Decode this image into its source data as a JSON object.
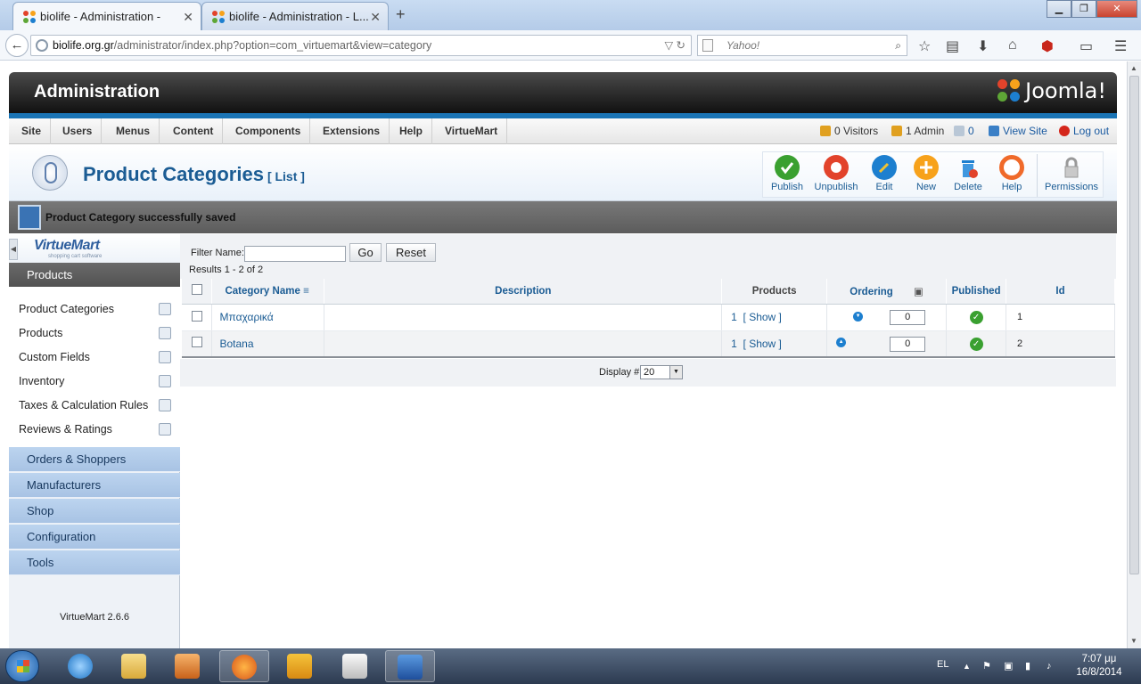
{
  "browser": {
    "tabs": [
      {
        "title": "biolife - Administration -"
      },
      {
        "title": "biolife - Administration - L..."
      }
    ],
    "url_domain": "biolife.org.gr",
    "url_path": "/administrator/index.php?option=com_virtuemart&view=category",
    "search_placeholder": "Yahoo!"
  },
  "header": {
    "title": "Administration",
    "brand": "Joomla!"
  },
  "menu": {
    "items": [
      "Site",
      "Users",
      "Menus",
      "Content",
      "Components",
      "Extensions",
      "Help",
      "VirtueMart"
    ],
    "visitors": "0 Visitors",
    "admins": "1 Admin",
    "messages": "0",
    "view_site": "View Site",
    "logout": "Log out"
  },
  "toolbar": {
    "page_title": "Product Categories",
    "page_subtitle": "[ List ]",
    "buttons": [
      "Publish",
      "Unpublish",
      "Edit",
      "New",
      "Delete",
      "Help",
      "Permissions"
    ]
  },
  "message": "Product Category successfully saved",
  "sidebar": {
    "logo_text": "VirtueMart",
    "logo_sub": "shopping cart software",
    "section": "Products",
    "items": [
      "Product Categories",
      "Products",
      "Custom Fields",
      "Inventory",
      "Taxes & Calculation Rules",
      "Reviews & Ratings"
    ],
    "groups": [
      "Orders & Shoppers",
      "Manufacturers",
      "Shop",
      "Configuration",
      "Tools"
    ],
    "version": "VirtueMart 2.6.6"
  },
  "filter": {
    "label": "Filter Name:",
    "value": "",
    "go": "Go",
    "reset": "Reset",
    "results": "Results 1 - 2 of 2"
  },
  "table": {
    "headers": {
      "name": "Category Name",
      "description": "Description",
      "products": "Products",
      "ordering": "Ordering",
      "published": "Published",
      "id": "Id"
    },
    "rows": [
      {
        "name": "Μπαχαρικά",
        "description": "",
        "count": "1",
        "show": "[ Show ]",
        "ordering": "0",
        "id": "1"
      },
      {
        "name": "Botana",
        "description": "",
        "count": "1",
        "show": "[ Show ]",
        "ordering": "0",
        "id": "2"
      }
    ]
  },
  "display": {
    "label": "Display #",
    "value": "20"
  },
  "taskbar": {
    "language": "EL",
    "time": "7:07 μμ",
    "date": "16/8/2014"
  }
}
